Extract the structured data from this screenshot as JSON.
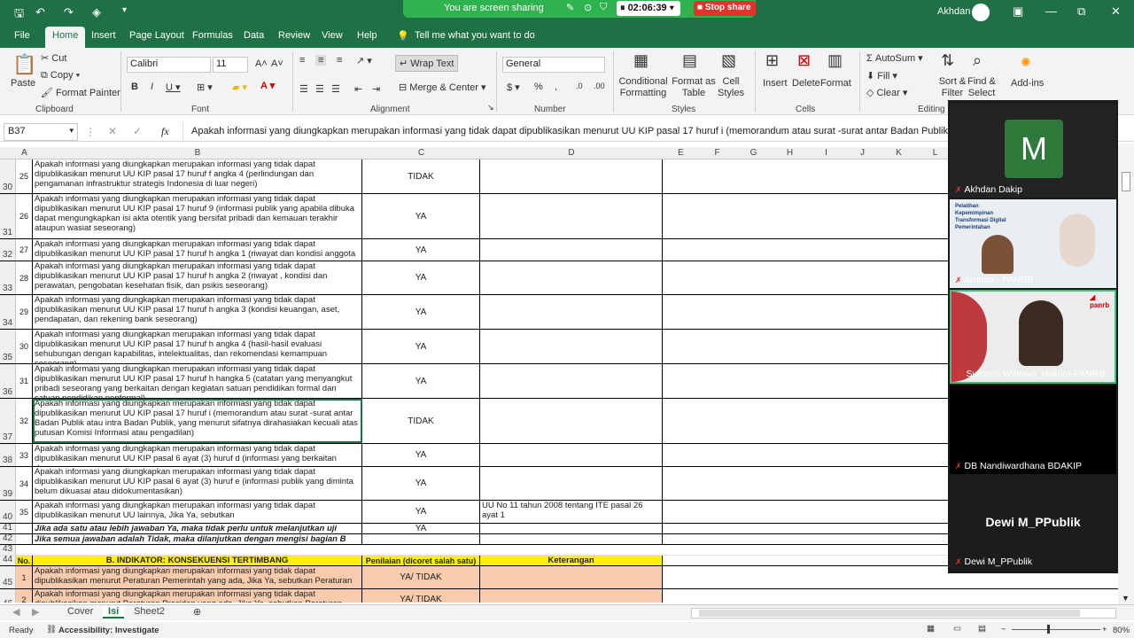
{
  "app": {
    "user": "Akhdan .",
    "window_min": "—",
    "window_max": "▭",
    "window_restore": "⧉",
    "window_close": "✕"
  },
  "share": {
    "text": "You are screen sharing",
    "timer": "02:06:39",
    "stop": "Stop share"
  },
  "menu": [
    "File",
    "Home",
    "Insert",
    "Page Layout",
    "Formulas",
    "Data",
    "Review",
    "View",
    "Help",
    "Tell me what you want to do"
  ],
  "ribbon": {
    "paste": "Paste",
    "cut": "Cut",
    "copy": "Copy",
    "format_painter": "Format Painter",
    "clipboard": "Clipboard",
    "font_name": "Calibri",
    "font_size": "11",
    "font": "Font",
    "wrap_text": "Wrap Text",
    "merge_center": "Merge & Center",
    "alignment": "Alignment",
    "number_format": "General",
    "number": "Number",
    "cond_fmt": "Conditional Formatting",
    "fmt_table": "Format as Table",
    "cell_styles": "Cell Styles",
    "styles": "Styles",
    "insert": "Insert",
    "delete": "Delete",
    "format": "Format",
    "cells": "Cells",
    "autosum": "AutoSum",
    "fill": "Fill",
    "clear": "Clear",
    "sort_filter": "Sort & Filter",
    "find_select": "Find & Select",
    "editing": "Editing",
    "addins": "Add-ins"
  },
  "formula_bar": {
    "name_box": "B37",
    "fx": "fx",
    "content": "Apakah informasi yang diungkapkan merupakan informasi yang tidak dapat dipublikasikan menurut UU KIP pasal 17 huruf i (memorandum atau surat -surat antar Badan Publik at"
  },
  "columns": [
    "A",
    "B",
    "C",
    "D",
    "E",
    "F",
    "G",
    "H",
    "I",
    "J",
    "K",
    "L"
  ],
  "rows": [
    {
      "rn": "30",
      "a": "25",
      "b": "Apakah informasi yang diungkapkan merupakan informasi yang tidak dapat dipublikasikan menurut UU KIP pasal 17 huruf f angka 4 (perlindungan dan pengamanan infrastruktur strategis Indonesia di luar negeri)",
      "c": "TIDAK",
      "d": ""
    },
    {
      "rn": "31",
      "a": "26",
      "b": "Apakah informasi yang diungkapkan merupakan informasi yang tidak dapat dipublikasikan menurut UU KIP pasal 17 huruf 9 (informasi publik yang apabila dibuka dapat mengungkapkan isi akta otentik yang bersifat pribadi dan kemauan terakhir ataupun wasiat seseorang)",
      "c": "YA",
      "d": ""
    },
    {
      "rn": "32",
      "a": "27",
      "b": "Apakah informasi yang diungkapkan merupakan informasi yang tidak dapat dipublikasikan menurut UU KIP pasal 17 huruf h angka 1 (riwayat dan kondisi anggota",
      "c": "YA",
      "d": ""
    },
    {
      "rn": "33",
      "a": "28",
      "b": "Apakah informasi yang diungkapkan merupakan informasi yang tidak dapat dipublikasikan menurut UU KIP pasal 17 huruf h angka 2 (riwayat , kondisi dan perawatan, pengobatan kesehatan fisik, dan psikis seseorang)",
      "c": "YA",
      "d": ""
    },
    {
      "rn": "34",
      "a": "29",
      "b": "Apakah informasi yang diungkapkan merupakan informasi yang tidak dapat dipublikasikan menurut UU KIP pasal 17 huruf h angka 3 (kondisi keuangan, aset, pendapatan, dan rekening bank seseorang)",
      "c": "YA",
      "d": ""
    },
    {
      "rn": "35",
      "a": "30",
      "b": "Apakah informasi yang diungkapkan merupakan informasi yang tidak dapat dipublikasikan menurut UU KIP pasal 17 huruf h angka 4 (hasil-hasil evaluasi sehubungan dengan kapabilitas, intelektualitas, dan rekomendasi kemampuan seseorang)",
      "c": "YA",
      "d": ""
    },
    {
      "rn": "36",
      "a": "31",
      "b": "Apakah informasi yang diungkapkan merupakan informasi yang tidak dapat dipublikasikan menurut UU KIP pasal 17 huruf h hangka 5 (catatan yang menyangkut pribadi seseorang yang berkaitan dengan kegiatan satuan pendidikan formal dan satuan pendidikan nonformal)",
      "c": "YA",
      "d": ""
    },
    {
      "rn": "37",
      "a": "32",
      "b": "Apakah informasi yang diungkapkan merupakan informasi yang tidak dapat dipublikasikan menurut UU KIP pasal 17 huruf i (memorandum atau surat -surat antar Badan Publik atau intra Badan Publik, yang menurut sifatnya dirahasiakan kecuali atas putusan Komisi Informasi atau pengadilan)",
      "c": "TIDAK",
      "d": ""
    },
    {
      "rn": "38",
      "a": "33",
      "b": "Apakah informasi yang diungkapkan merupakan informasi yang tidak dapat dipublikasikan menurut UU KIP pasal 6 ayat (3) huruf d (informasi yang berkaitan dengan",
      "c": "YA",
      "d": ""
    },
    {
      "rn": "39",
      "a": "34",
      "b": "Apakah informasi yang diungkapkan merupakan informasi yang tidak dapat dipublikasikan menurut UU KIP pasal 6 ayat (3) huruf e (informasi publik yang diminta belum dikuasai atau didokumentasikan)",
      "c": "YA",
      "d": ""
    },
    {
      "rn": "40",
      "a": "35",
      "b": "Apakah informasi yang diungkapkan merupakan informasi yang tidak dapat dipublikasikan menurut UU lainnya, Jika Ya, sebutkan",
      "c": "YA",
      "d": "UU No 11 tahun 2008 tentang ITE pasal 26 ayat 1"
    },
    {
      "rn": "41",
      "a": "",
      "b": "Jika ada satu atau lebih jawaban Ya, maka tidak perlu untuk melanjutkan uji",
      "c": "YA",
      "d": ""
    },
    {
      "rn": "42",
      "a": "",
      "b": "Jika semua jawaban adalah Tidak, maka dilanjutkan dengan mengisi bagian B",
      "c": "",
      "d": ""
    },
    {
      "rn": "43",
      "a": "",
      "b": "",
      "c": "",
      "d": ""
    },
    {
      "rn": "44",
      "a": "No.",
      "b": "B. INDIKATOR: KONSEKUENSI TERTIMBANG",
      "c": "Penilaian  (dicoret salah satu)",
      "d": "Keterangan"
    },
    {
      "rn": "45",
      "a": "1",
      "b": "Apakah informasi yang diungkapkan merupakan informasi yang tidak dapat dipublikasikan menurut Peraturan Pemerintah yang ada, Jika Ya, sebutkan Peraturan",
      "c": "YA/ TIDAK",
      "d": ""
    },
    {
      "rn": "46",
      "a": "2",
      "b": "Apakah informasi yang diungkapkan merupakan informasi yang tidak dapat dipublikasikan menurut Peraturan Presiden yang ada, Jika Ya, sebutkan Peraturan",
      "c": "YA/ TIDAK",
      "d": ""
    }
  ],
  "sheet_tabs": [
    "Cover",
    "Isi",
    "Sheet2"
  ],
  "status": {
    "ready": "Ready",
    "accessibility": "Accessibility: Investigate",
    "zoom": "80%"
  },
  "participants": [
    {
      "name": "Akhdan Dakip",
      "initial": "M"
    },
    {
      "name": "Ananta - PANRB",
      "slide_title": "Pelatihan Kepemimpinan Transformasi Digital Pemerintahan"
    },
    {
      "name": "Sutrisno Wibowo_Hukum-PANRB"
    },
    {
      "name": "DB Nandiwardhana BDAKIP"
    },
    {
      "name": "Dewi M_PPublik",
      "big": "Dewi M_PPublik"
    }
  ]
}
